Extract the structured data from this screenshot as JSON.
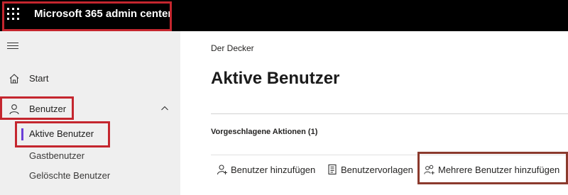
{
  "app": {
    "title": "Microsoft 365 admin center",
    "launcher_icon": "app-launcher-icon"
  },
  "sidebar": {
    "menu_icon": "hamburger-icon",
    "items": [
      {
        "label": "Start",
        "icon": "home-icon"
      },
      {
        "label": "Benutzer",
        "icon": "user-icon",
        "expanded": true
      }
    ],
    "subitems": [
      {
        "label": "Aktive Benutzer",
        "active": true
      },
      {
        "label": "Gastbenutzer"
      },
      {
        "label": "Gelöschte Benutzer"
      }
    ]
  },
  "main": {
    "breadcrumb": "Der Decker",
    "title": "Aktive Benutzer",
    "suggested_actions": "Vorgeschlagene Aktionen (1)",
    "commands": [
      {
        "label": "Benutzer hinzufügen",
        "icon": "add-user-icon"
      },
      {
        "label": "Benutzervorlagen",
        "icon": "template-icon"
      },
      {
        "label": "Mehrere Benutzer hinzufügen",
        "icon": "add-multiple-users-icon"
      }
    ]
  },
  "colors": {
    "topbar": "#000000",
    "sidebar": "#efefef",
    "active_indicator": "#6b3fd7",
    "highlight": "#c4262e"
  }
}
